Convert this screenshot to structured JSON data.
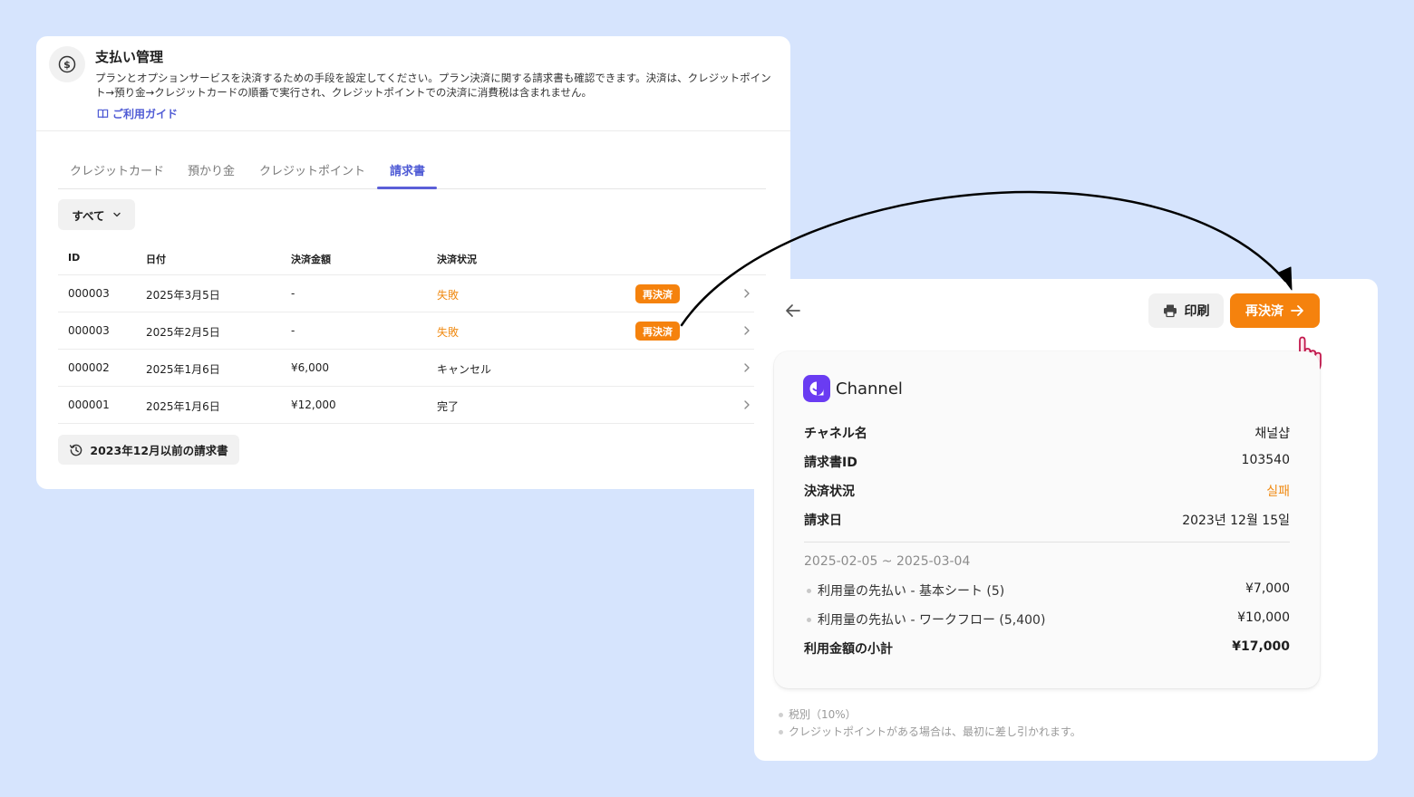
{
  "payment": {
    "title": "支払い管理",
    "description": "プランとオプションサービスを決済するための手段を設定してください。プラン決済に関する請求書も確認できます。決済は、クレジットポイント→預り金→クレジットカードの順番で実行され、クレジットポイントでの決済に消費税は含まれません。",
    "guide_link": "ご利用ガイド",
    "icon": "dollar-circle-icon"
  },
  "tabs": [
    {
      "label": "クレジットカード"
    },
    {
      "label": "預かり金"
    },
    {
      "label": "クレジットポイント"
    },
    {
      "label": "請求書",
      "active": true
    }
  ],
  "filter": {
    "label": "すべて"
  },
  "table": {
    "headers": [
      "ID",
      "日付",
      "決済金額",
      "決済状況"
    ],
    "rows": [
      {
        "id": "000003",
        "date": "2025年3月5日",
        "amount": "-",
        "status": "失敗",
        "action": "再決済"
      },
      {
        "id": "000003",
        "date": "2025年2月5日",
        "amount": "-",
        "status": "失敗",
        "action": "再決済"
      },
      {
        "id": "000002",
        "date": "2025年1月6日",
        "amount": "¥6,000",
        "status": "キャンセル"
      },
      {
        "id": "000001",
        "date": "2025年1月6日",
        "amount": "¥12,000",
        "status": "完了"
      }
    ]
  },
  "old_invoices_label": "2023年12月以前の請求書",
  "detail": {
    "print_label": "印刷",
    "repay_label": "再決済",
    "brand": "Channel",
    "fields": [
      {
        "label": "チャネル名",
        "value": "채널샵"
      },
      {
        "label": "請求書ID",
        "value": "103540"
      },
      {
        "label": "決済状況",
        "value": "실패"
      },
      {
        "label": "請求日",
        "value": "2023년 12월 15일"
      }
    ],
    "period": "2025-02-05 ~ 2025-03-04",
    "line_items": [
      {
        "name": "利用量の先払い - 基本シート (5)",
        "amount": "¥7,000"
      },
      {
        "name": "利用量の先払い - ワークフロー (5,400)",
        "amount": "¥10,000"
      }
    ],
    "subtotal_label": "利用金額の小計",
    "subtotal_value": "¥17,000",
    "notes": [
      "税別（10%）",
      "クレジットポイントがある場合は、最初に差し引かれます。"
    ]
  },
  "colors": {
    "background": "#d6e4fd",
    "accent": "#5b5fd8",
    "orange": "#f5820d",
    "brand_purple": "#6a3cf2"
  }
}
